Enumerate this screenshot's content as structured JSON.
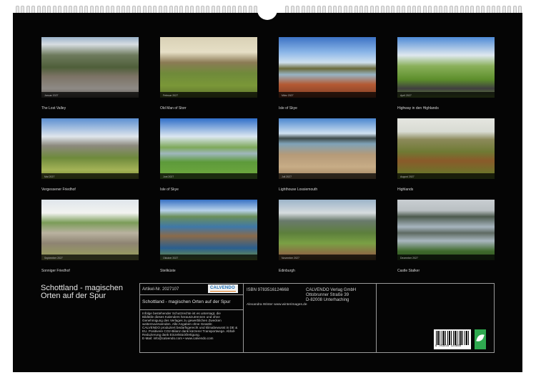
{
  "calendar": {
    "title": "Schottland - magischen Orten auf der Spur",
    "months": [
      {
        "caption": "The Lost Valley",
        "month": "Januar 2027"
      },
      {
        "caption": "Old Man of Storr",
        "month": "Februar 2027"
      },
      {
        "caption": "Isle of Skye",
        "month": "März 2027"
      },
      {
        "caption": "Highway in den Highlands",
        "month": "April 2027"
      },
      {
        "caption": "Vergessener Friedhof",
        "month": "Mai 2027"
      },
      {
        "caption": "Isle of Skye",
        "month": "Juni 2027"
      },
      {
        "caption": "Lighthouse Lossiemouth",
        "month": "Juli 2027"
      },
      {
        "caption": "Highlands",
        "month": "August 2027"
      },
      {
        "caption": "Sonniger Friedhof",
        "month": "September 2027"
      },
      {
        "caption": "Steilküste",
        "month": "Oktober 2027"
      },
      {
        "caption": "Edinburgh",
        "month": "November 2027"
      },
      {
        "caption": "Castle Stalker",
        "month": "Dezember 2027"
      }
    ]
  },
  "info": {
    "article_no": "Artikel-Nr. 2027107",
    "product_title": "Schottland - magischen Orten auf der Spur",
    "isbn": "ISBN 9783516124668",
    "publisher": [
      "CALVENDO Verlag GmbH",
      "Ottobrunner Straße 39",
      "D-82008 Unterhaching"
    ],
    "author": "Alexandra Winter www.winterimages.de",
    "logo_text": "CALVENDO",
    "barcode_number": "9 783516 124668",
    "legal": [
      "Infolge bestehender Schutzrechte ist es untersagt, die",
      "Bildteile dieses Kalenders herauszutrennen und ohne",
      "Genehmigung des Verlages zu gewerblichen Zwecken",
      "weiterzuverwenden. Alle Angaben ohne Gewähr.",
      "CALVENDO produziert bedarfsgerecht und klimabewusst in DE &",
      "EU. Positivere CO2-Bilanz dank kürzerer Transportwege. Abfall-",
      "Reduzierung dank Einzelstückfertigung.",
      "E-Mail: info@calvendo.com • www.calvendo.com"
    ]
  },
  "colors": {
    "sheet": "#050505",
    "text": "#d8d8d8",
    "brand": "#1b6fb8",
    "eco": "#2fa84f"
  }
}
